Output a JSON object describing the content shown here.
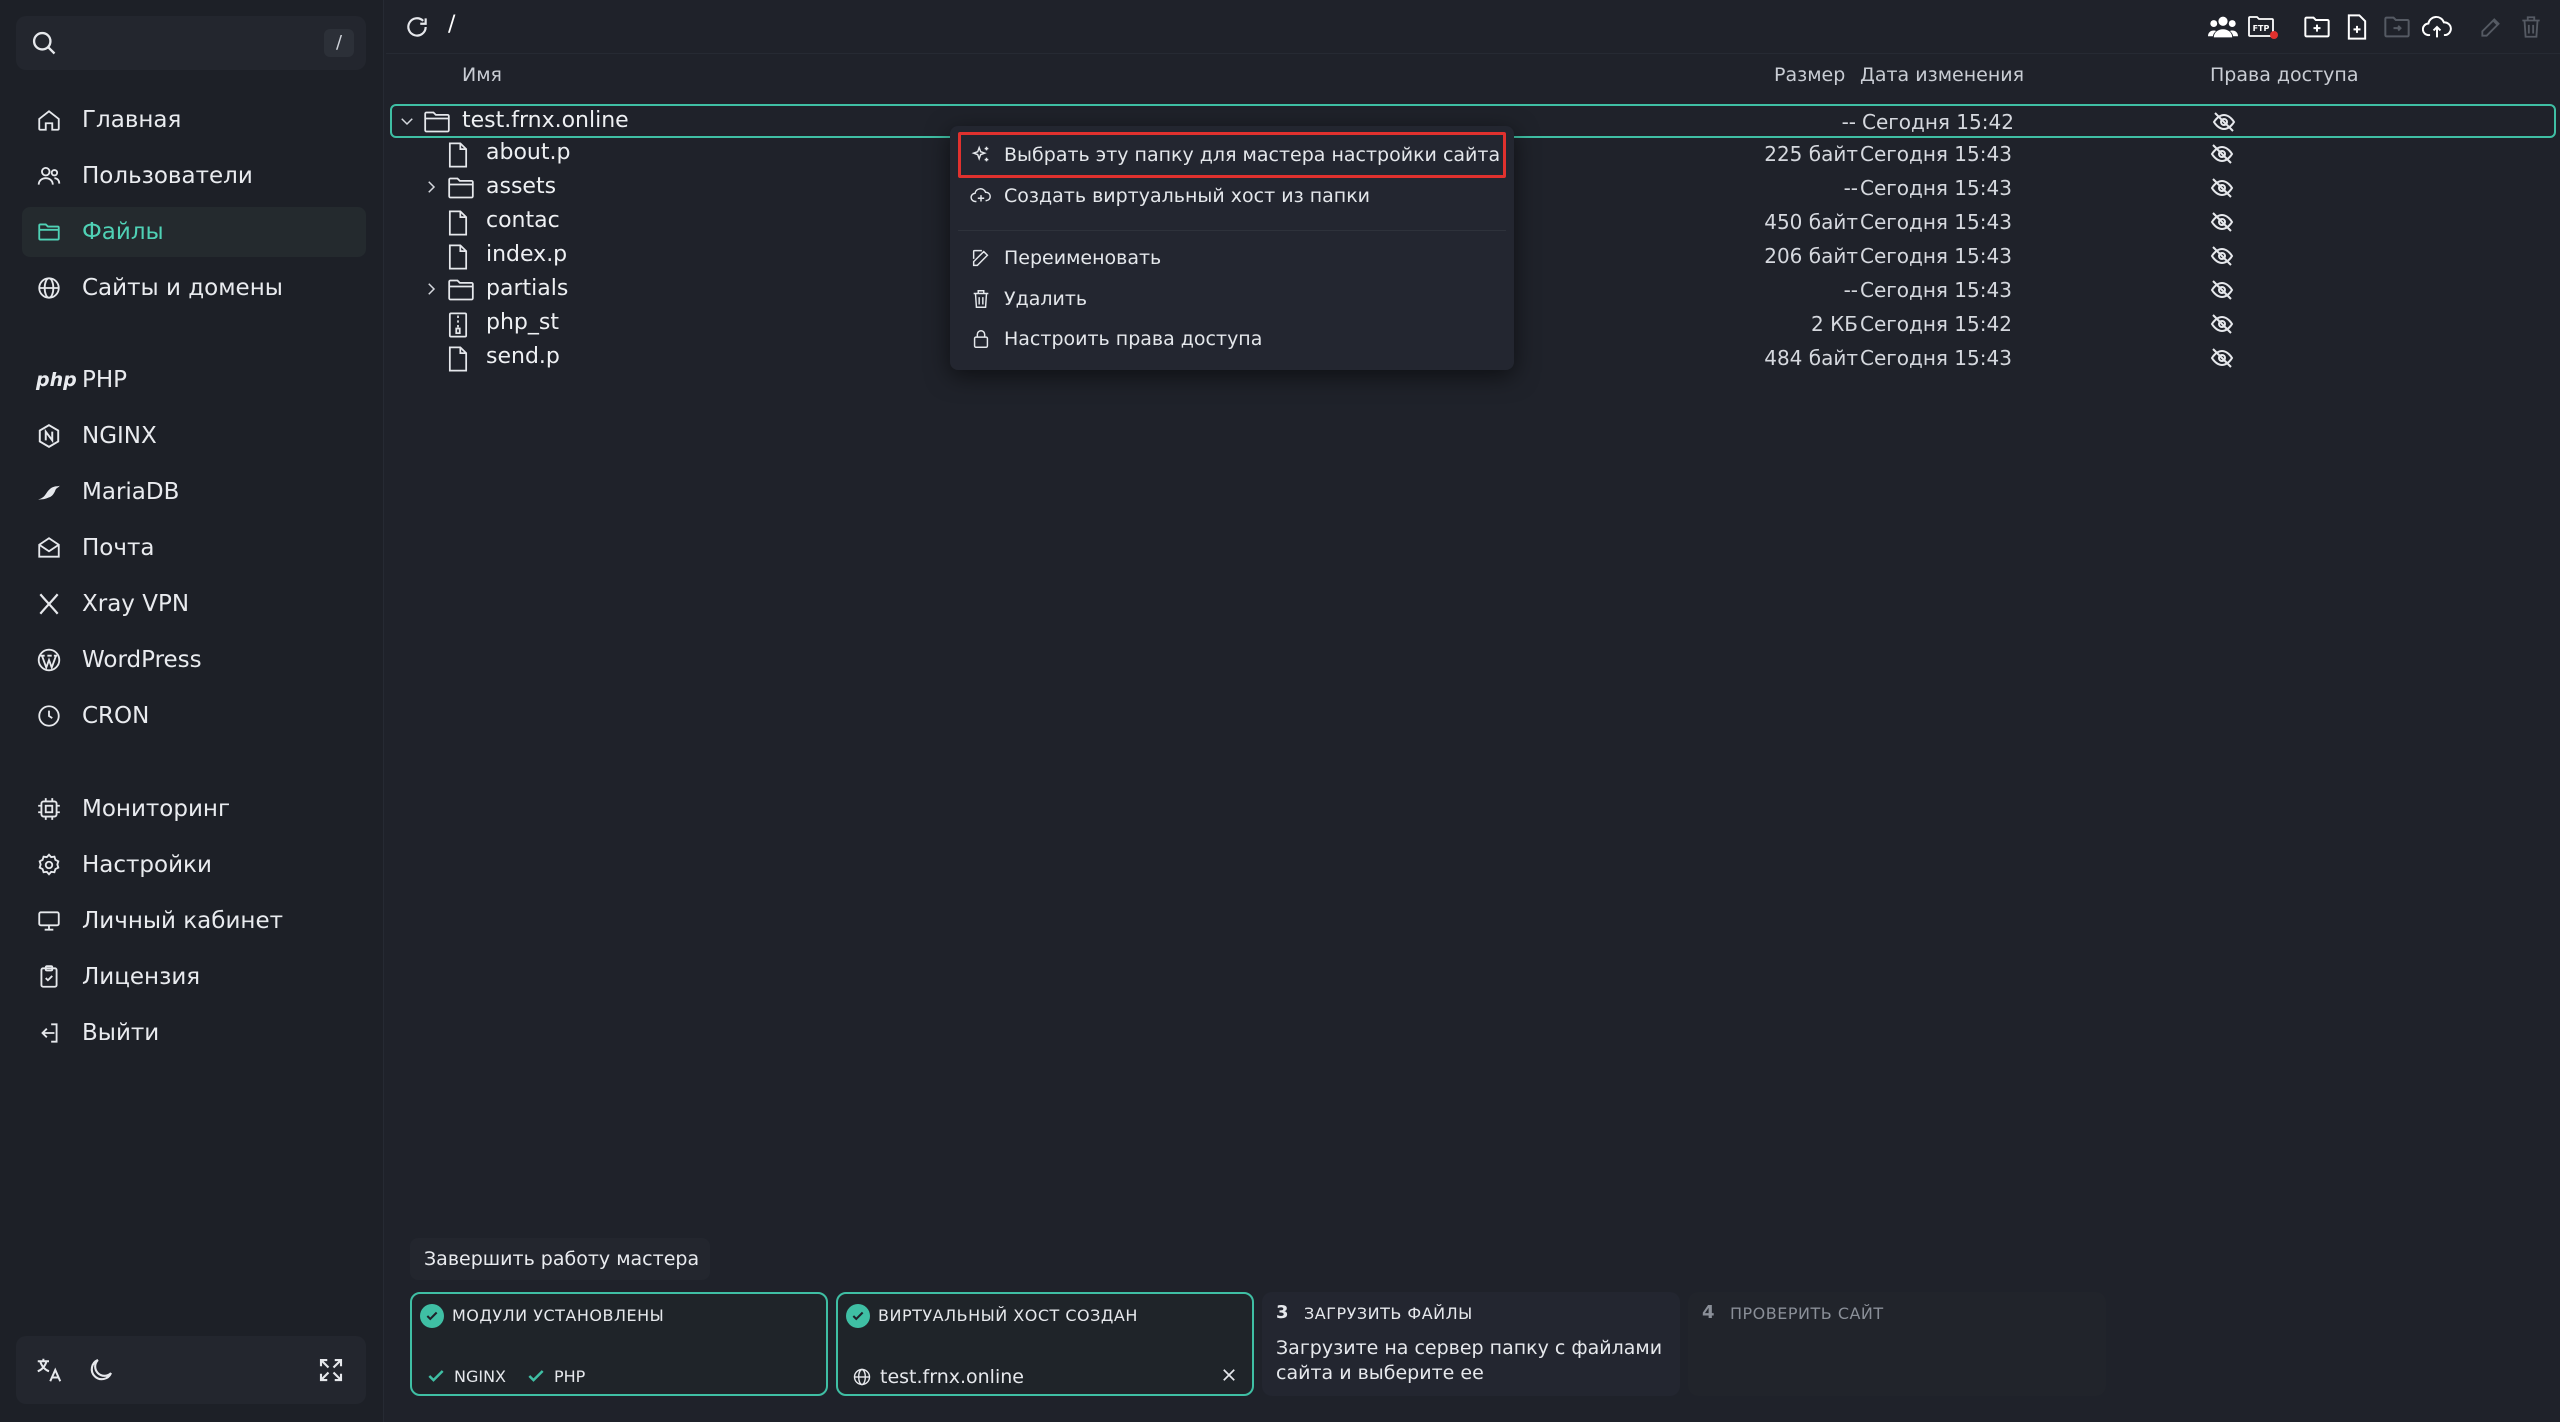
{
  "search": {
    "shortcut": "/"
  },
  "sidebar": {
    "items": [
      {
        "label": "Главная",
        "icon": "home-icon"
      },
      {
        "label": "Пользователи",
        "icon": "users-icon"
      },
      {
        "label": "Файлы",
        "icon": "folder-icon",
        "active": true
      },
      {
        "label": "Сайты и домены",
        "icon": "globe-icon"
      },
      {
        "label": "PHP",
        "icon": "php-icon",
        "logo_text": "php"
      },
      {
        "label": "NGINX",
        "icon": "nginx-icon"
      },
      {
        "label": "MariaDB",
        "icon": "mariadb-icon"
      },
      {
        "label": "Почта",
        "icon": "mail-icon"
      },
      {
        "label": "Xray VPN",
        "icon": "xray-icon"
      },
      {
        "label": "WordPress",
        "icon": "wordpress-icon"
      },
      {
        "label": "CRON",
        "icon": "clock-icon"
      },
      {
        "label": "Мониторинг",
        "icon": "chip-icon"
      },
      {
        "label": "Настройки",
        "icon": "gear-icon"
      },
      {
        "label": "Личный кабинет",
        "icon": "monitor-icon"
      },
      {
        "label": "Лицензия",
        "icon": "license-icon"
      },
      {
        "label": "Выйти",
        "icon": "logout-icon"
      }
    ]
  },
  "toolbar": {
    "path": "/",
    "ftp_label": "FTP"
  },
  "table": {
    "headers": {
      "name": "Имя",
      "size": "Размер",
      "date": "Дата изменения",
      "perm": "Права доступа"
    },
    "rows": [
      {
        "name": "test.frnx.online",
        "type": "folder",
        "size": "--",
        "date": "Сегодня 15:42"
      },
      {
        "name": "about.p",
        "type": "file",
        "size": "225 байт",
        "date": "Сегодня 15:43"
      },
      {
        "name": "assets",
        "type": "folder",
        "size": "--",
        "date": "Сегодня 15:43"
      },
      {
        "name": "contac",
        "type": "file",
        "size": "450 байт",
        "date": "Сегодня 15:43"
      },
      {
        "name": "index.p",
        "type": "file",
        "size": "206 байт",
        "date": "Сегодня 15:43"
      },
      {
        "name": "partials",
        "type": "folder",
        "size": "--",
        "date": "Сегодня 15:43"
      },
      {
        "name": "php_st",
        "type": "archive",
        "size": "2 КБ",
        "date": "Сегодня 15:42"
      },
      {
        "name": "send.p",
        "type": "file",
        "size": "484 байт",
        "date": "Сегодня 15:43"
      }
    ]
  },
  "context_menu": {
    "select_folder": "Выбрать эту папку для мастера настройки сайта",
    "create_vhost": "Создать виртуальный хост из папки",
    "rename": "Переименовать",
    "delete": "Удалить",
    "permissions": "Настроить права доступа"
  },
  "wizard": {
    "finish": "Завершить работу мастера",
    "step1": {
      "title": "МОДУЛИ УСТАНОВЛЕНЫ",
      "chip1": "NGINX",
      "chip2": "PHP"
    },
    "step2": {
      "title": "ВИРТУАЛЬНЫЙ ХОСТ СОЗДАН",
      "host": "test.frnx.online"
    },
    "step3": {
      "num": "3",
      "title": "ЗАГРУЗИТЬ ФАЙЛЫ",
      "desc": "Загрузите на сервер папку с файлами сайта и выберите ее"
    },
    "step4": {
      "num": "4",
      "title": "ПРОВЕРИТЬ САЙТ"
    }
  },
  "colors": {
    "accent": "#3fbfa4",
    "active_text": "#4fd1b5",
    "highlight": "#e0312e",
    "bg": "#1f222a"
  }
}
